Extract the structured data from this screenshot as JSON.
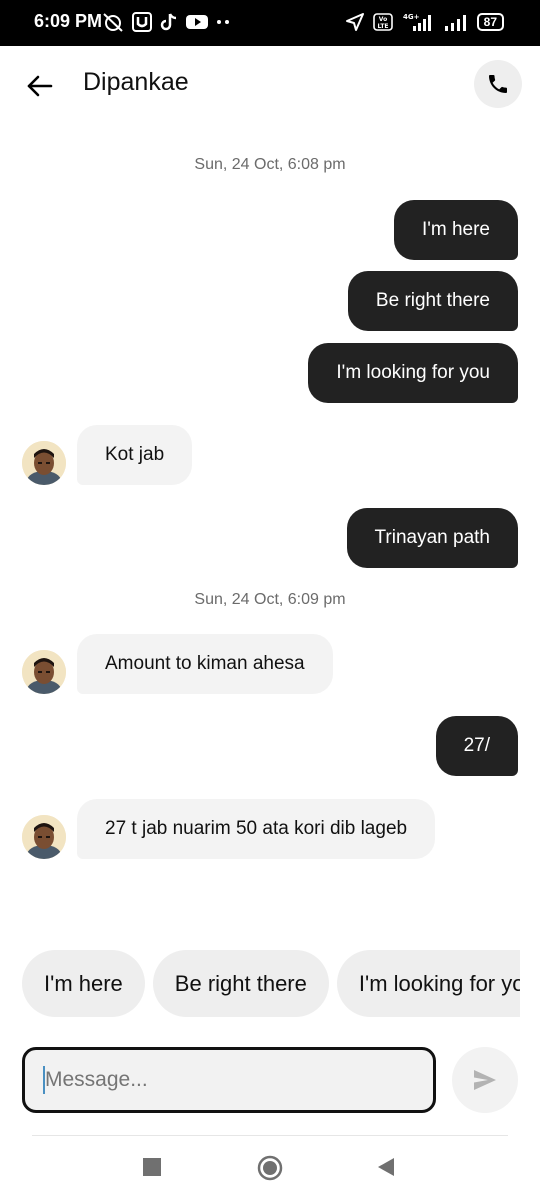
{
  "status_bar": {
    "time": "6:09 PM",
    "icons_left": [
      "alarm-off-icon",
      "u-app-icon",
      "tiktok-icon",
      "youtube-icon",
      "more-dots-icon"
    ],
    "icons_right": [
      "location-icon",
      "volte-icon",
      "4g-signal-icon",
      "signal-icon"
    ],
    "volte_label": "Vo LTE",
    "network_label": "4G+",
    "battery": "87"
  },
  "header": {
    "contact_name": "Dipankae",
    "back_icon": "arrow-left-icon",
    "call_icon": "phone-icon"
  },
  "messages": [
    {
      "type": "timestamp",
      "text": "Sun, 24 Oct, 6:08 pm"
    },
    {
      "type": "out",
      "text": "I'm here"
    },
    {
      "type": "out",
      "text": "Be right there"
    },
    {
      "type": "out",
      "text": "I'm looking for you"
    },
    {
      "type": "in",
      "text": "Kot jab"
    },
    {
      "type": "out",
      "text": "Trinayan path"
    },
    {
      "type": "timestamp",
      "text": "Sun, 24 Oct, 6:09 pm"
    },
    {
      "type": "in",
      "text": "Amount to kiman ahesa"
    },
    {
      "type": "out",
      "text": "27/"
    },
    {
      "type": "in",
      "text": "27 t jab nuarim 50 ata kori dib lageb"
    }
  ],
  "quick_replies": [
    "I'm here",
    "Be right there",
    "I'm looking for you"
  ],
  "composer": {
    "placeholder": "Message...",
    "value": "",
    "send_icon": "send-icon"
  },
  "nav_bar": {
    "icons": [
      "recents-square-icon",
      "home-circle-icon",
      "back-triangle-icon"
    ]
  }
}
